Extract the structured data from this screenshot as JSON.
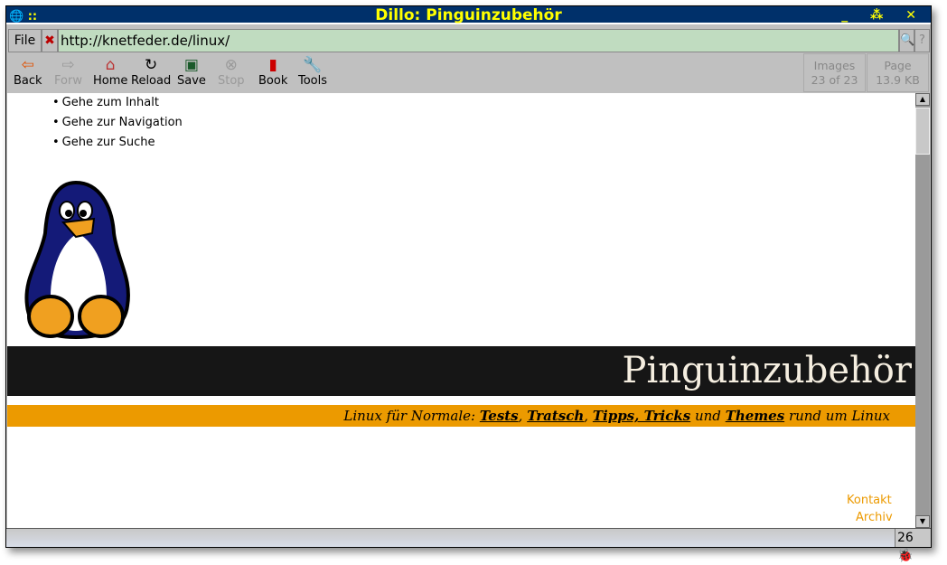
{
  "window": {
    "title": "Dillo: Pinguinzubehör"
  },
  "menu": {
    "file": "File",
    "url": "http://knetfeder.de/linux/"
  },
  "toolbar": {
    "back": "Back",
    "forward": "Forw",
    "home": "Home",
    "reload": "Reload",
    "save": "Save",
    "stop": "Stop",
    "book": "Book",
    "tools": "Tools"
  },
  "info": {
    "images_label": "Images",
    "images_value": "23 of 23",
    "page_label": "Page",
    "page_value": "13.9 KB"
  },
  "page": {
    "skip_links": [
      "Gehe zum Inhalt",
      "Gehe zur Navigation",
      "Gehe zur Suche"
    ],
    "heading": "Pinguinzubehör",
    "tagline": {
      "prefix": "Linux für Normale: ",
      "l1": "Tests",
      "s1": ", ",
      "l2": "Tratsch",
      "s2": ", ",
      "l3": "Tipps, Tricks",
      "s3": " und ",
      "l4": "Themes",
      "suffix": " rund um Linux"
    },
    "side_links": [
      "Kontakt",
      "Archiv"
    ]
  },
  "status": {
    "bug_count": "26"
  },
  "colors": {
    "title_bg": "#00306a",
    "title_fg": "#ffff00",
    "url_bg": "#c0dcc0",
    "banner_bg": "#161616",
    "tag_bg": "#ec9a00",
    "link": "#ec9a00"
  }
}
